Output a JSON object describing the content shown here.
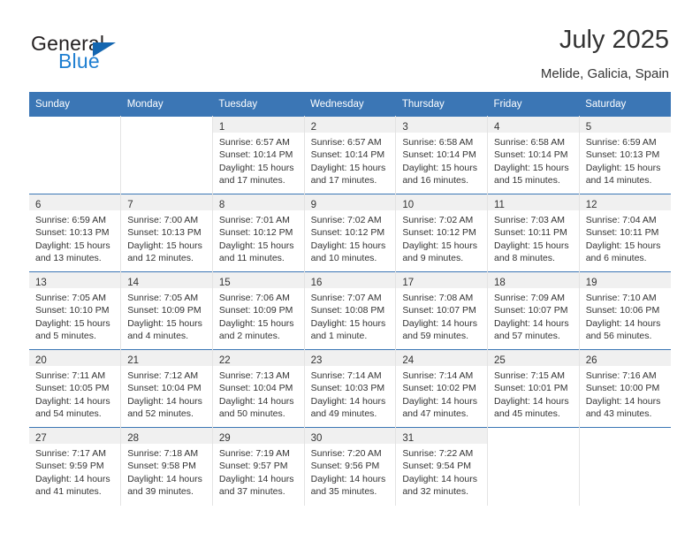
{
  "brand": {
    "name_top": "General",
    "name_bottom": "Blue",
    "triangle_color": "#1466b0",
    "blue_text_color": "#1f7fd1"
  },
  "header": {
    "title": "July 2025",
    "subtitle": "Melide, Galicia, Spain"
  },
  "theme": {
    "header_bg": "#3b76b5",
    "daynum_band_bg": "#f0f0f0",
    "row_border": "#3b76b5",
    "cell_border": "#e3e3e3",
    "text": "#333333"
  },
  "weekday_headers": [
    "Sunday",
    "Monday",
    "Tuesday",
    "Wednesday",
    "Thursday",
    "Friday",
    "Saturday"
  ],
  "weeks": [
    [
      {
        "day": "",
        "lines": []
      },
      {
        "day": "",
        "lines": []
      },
      {
        "day": "1",
        "lines": [
          "Sunrise: 6:57 AM",
          "Sunset: 10:14 PM",
          "Daylight: 15 hours",
          "and 17 minutes."
        ]
      },
      {
        "day": "2",
        "lines": [
          "Sunrise: 6:57 AM",
          "Sunset: 10:14 PM",
          "Daylight: 15 hours",
          "and 17 minutes."
        ]
      },
      {
        "day": "3",
        "lines": [
          "Sunrise: 6:58 AM",
          "Sunset: 10:14 PM",
          "Daylight: 15 hours",
          "and 16 minutes."
        ]
      },
      {
        "day": "4",
        "lines": [
          "Sunrise: 6:58 AM",
          "Sunset: 10:14 PM",
          "Daylight: 15 hours",
          "and 15 minutes."
        ]
      },
      {
        "day": "5",
        "lines": [
          "Sunrise: 6:59 AM",
          "Sunset: 10:13 PM",
          "Daylight: 15 hours",
          "and 14 minutes."
        ]
      }
    ],
    [
      {
        "day": "6",
        "lines": [
          "Sunrise: 6:59 AM",
          "Sunset: 10:13 PM",
          "Daylight: 15 hours",
          "and 13 minutes."
        ]
      },
      {
        "day": "7",
        "lines": [
          "Sunrise: 7:00 AM",
          "Sunset: 10:13 PM",
          "Daylight: 15 hours",
          "and 12 minutes."
        ]
      },
      {
        "day": "8",
        "lines": [
          "Sunrise: 7:01 AM",
          "Sunset: 10:12 PM",
          "Daylight: 15 hours",
          "and 11 minutes."
        ]
      },
      {
        "day": "9",
        "lines": [
          "Sunrise: 7:02 AM",
          "Sunset: 10:12 PM",
          "Daylight: 15 hours",
          "and 10 minutes."
        ]
      },
      {
        "day": "10",
        "lines": [
          "Sunrise: 7:02 AM",
          "Sunset: 10:12 PM",
          "Daylight: 15 hours",
          "and 9 minutes."
        ]
      },
      {
        "day": "11",
        "lines": [
          "Sunrise: 7:03 AM",
          "Sunset: 10:11 PM",
          "Daylight: 15 hours",
          "and 8 minutes."
        ]
      },
      {
        "day": "12",
        "lines": [
          "Sunrise: 7:04 AM",
          "Sunset: 10:11 PM",
          "Daylight: 15 hours",
          "and 6 minutes."
        ]
      }
    ],
    [
      {
        "day": "13",
        "lines": [
          "Sunrise: 7:05 AM",
          "Sunset: 10:10 PM",
          "Daylight: 15 hours",
          "and 5 minutes."
        ]
      },
      {
        "day": "14",
        "lines": [
          "Sunrise: 7:05 AM",
          "Sunset: 10:09 PM",
          "Daylight: 15 hours",
          "and 4 minutes."
        ]
      },
      {
        "day": "15",
        "lines": [
          "Sunrise: 7:06 AM",
          "Sunset: 10:09 PM",
          "Daylight: 15 hours",
          "and 2 minutes."
        ]
      },
      {
        "day": "16",
        "lines": [
          "Sunrise: 7:07 AM",
          "Sunset: 10:08 PM",
          "Daylight: 15 hours",
          "and 1 minute."
        ]
      },
      {
        "day": "17",
        "lines": [
          "Sunrise: 7:08 AM",
          "Sunset: 10:07 PM",
          "Daylight: 14 hours",
          "and 59 minutes."
        ]
      },
      {
        "day": "18",
        "lines": [
          "Sunrise: 7:09 AM",
          "Sunset: 10:07 PM",
          "Daylight: 14 hours",
          "and 57 minutes."
        ]
      },
      {
        "day": "19",
        "lines": [
          "Sunrise: 7:10 AM",
          "Sunset: 10:06 PM",
          "Daylight: 14 hours",
          "and 56 minutes."
        ]
      }
    ],
    [
      {
        "day": "20",
        "lines": [
          "Sunrise: 7:11 AM",
          "Sunset: 10:05 PM",
          "Daylight: 14 hours",
          "and 54 minutes."
        ]
      },
      {
        "day": "21",
        "lines": [
          "Sunrise: 7:12 AM",
          "Sunset: 10:04 PM",
          "Daylight: 14 hours",
          "and 52 minutes."
        ]
      },
      {
        "day": "22",
        "lines": [
          "Sunrise: 7:13 AM",
          "Sunset: 10:04 PM",
          "Daylight: 14 hours",
          "and 50 minutes."
        ]
      },
      {
        "day": "23",
        "lines": [
          "Sunrise: 7:14 AM",
          "Sunset: 10:03 PM",
          "Daylight: 14 hours",
          "and 49 minutes."
        ]
      },
      {
        "day": "24",
        "lines": [
          "Sunrise: 7:14 AM",
          "Sunset: 10:02 PM",
          "Daylight: 14 hours",
          "and 47 minutes."
        ]
      },
      {
        "day": "25",
        "lines": [
          "Sunrise: 7:15 AM",
          "Sunset: 10:01 PM",
          "Daylight: 14 hours",
          "and 45 minutes."
        ]
      },
      {
        "day": "26",
        "lines": [
          "Sunrise: 7:16 AM",
          "Sunset: 10:00 PM",
          "Daylight: 14 hours",
          "and 43 minutes."
        ]
      }
    ],
    [
      {
        "day": "27",
        "lines": [
          "Sunrise: 7:17 AM",
          "Sunset: 9:59 PM",
          "Daylight: 14 hours",
          "and 41 minutes."
        ]
      },
      {
        "day": "28",
        "lines": [
          "Sunrise: 7:18 AM",
          "Sunset: 9:58 PM",
          "Daylight: 14 hours",
          "and 39 minutes."
        ]
      },
      {
        "day": "29",
        "lines": [
          "Sunrise: 7:19 AM",
          "Sunset: 9:57 PM",
          "Daylight: 14 hours",
          "and 37 minutes."
        ]
      },
      {
        "day": "30",
        "lines": [
          "Sunrise: 7:20 AM",
          "Sunset: 9:56 PM",
          "Daylight: 14 hours",
          "and 35 minutes."
        ]
      },
      {
        "day": "31",
        "lines": [
          "Sunrise: 7:22 AM",
          "Sunset: 9:54 PM",
          "Daylight: 14 hours",
          "and 32 minutes."
        ]
      },
      {
        "day": "",
        "lines": []
      },
      {
        "day": "",
        "lines": []
      }
    ]
  ]
}
